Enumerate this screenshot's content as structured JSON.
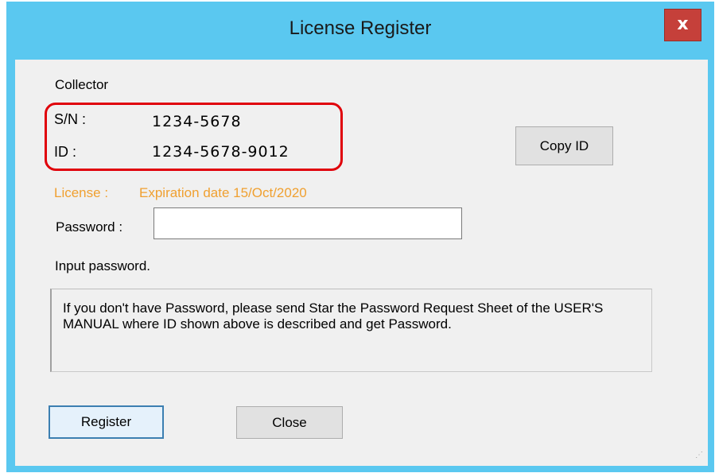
{
  "window": {
    "title": "License Register",
    "close_glyph": "x"
  },
  "collector": {
    "heading": "Collector",
    "sn_label": "S/N :",
    "sn_value": "1234-5678",
    "id_label": "ID :",
    "id_value": "1234-5678-9012"
  },
  "copy_id_button": "Copy ID",
  "license": {
    "label": "License :",
    "expiration": "Expiration date 15/Oct/2020"
  },
  "password": {
    "label": "Password :",
    "value": "",
    "placeholder": "",
    "hint": "Input password."
  },
  "info_text": "If you don't have Password, please send Star the Password Request Sheet of the USER'S MANUAL where ID shown above is described and get Password.",
  "buttons": {
    "register": "Register",
    "close": "Close"
  },
  "colors": {
    "titlebar": "#5ac8f0",
    "close_button": "#c5403a",
    "license_text": "#f0a030",
    "highlight_border": "#e0000a"
  }
}
